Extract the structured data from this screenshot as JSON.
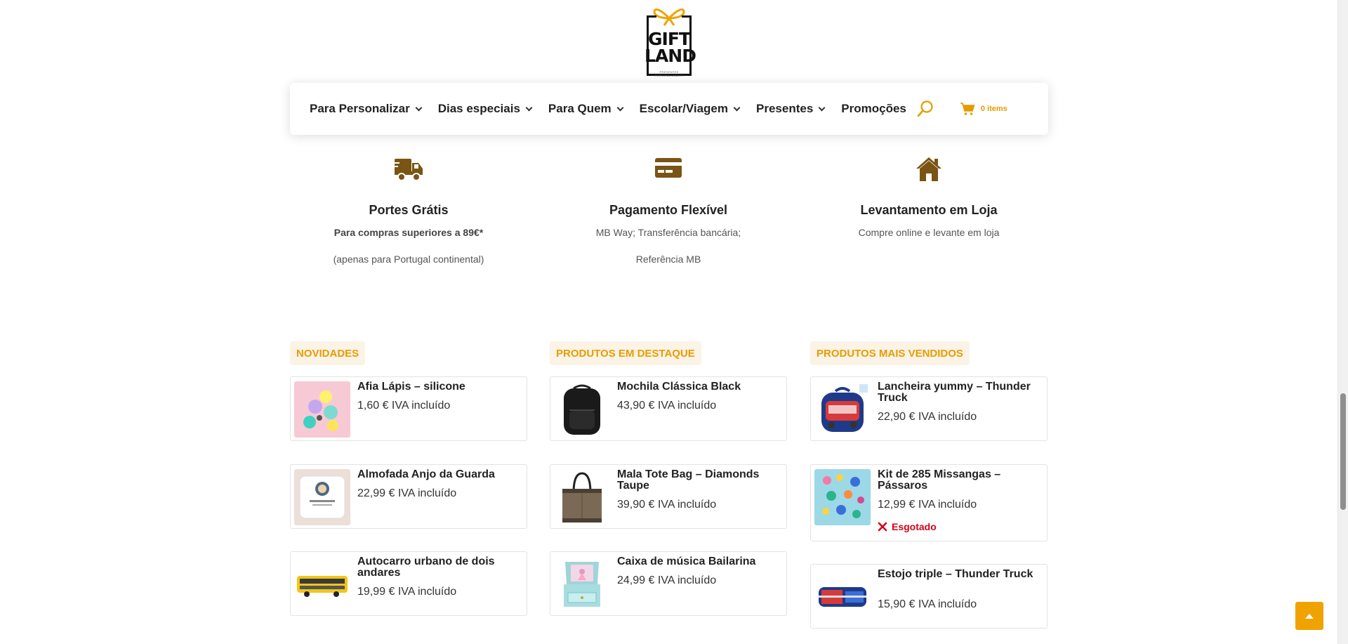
{
  "brand": {
    "logo_top": "GIFT",
    "logo_bottom": "LAND",
    "tagline": "PRESENTES PERSONALIZADOS"
  },
  "nav": {
    "items": [
      {
        "label": "Para Personalizar",
        "dropdown": true
      },
      {
        "label": "Dias especiais",
        "dropdown": true
      },
      {
        "label": "Para Quem",
        "dropdown": true
      },
      {
        "label": "Escolar/Viagem",
        "dropdown": true
      },
      {
        "label": "Presentes",
        "dropdown": true
      },
      {
        "label": "Promoções",
        "dropdown": false
      }
    ],
    "search_icon": "search-icon",
    "cart_icon": "cart-icon",
    "cart_label": "0 items"
  },
  "features": [
    {
      "icon": "truck-icon",
      "title": "Portes Grátis",
      "line1": "Para compras superiores a 89€*",
      "line2": "(apenas para Portugal continental)"
    },
    {
      "icon": "credit-card-icon",
      "title": "Pagamento Flexível",
      "line1": "MB Way;  Transferência bancária;",
      "line2": "Referência MB"
    },
    {
      "icon": "home-icon",
      "title": "Levantamento em Loja",
      "line1": "Compre online e levante em loja",
      "line2": ""
    }
  ],
  "columns": [
    {
      "header": "Novidades",
      "products": [
        {
          "title": "Afia Lápis – silicone",
          "price": "1,60 € IVA incluído"
        },
        {
          "title": "Almofada Anjo da Guarda",
          "price": "22,99 € IVA incluído"
        },
        {
          "title": "Autocarro urbano de dois andares",
          "price": "19,99 € IVA incluído"
        }
      ]
    },
    {
      "header": "Produtos em destaque",
      "products": [
        {
          "title": "Mochila Clássica Black",
          "price": "43,90 € IVA incluído"
        },
        {
          "title": "Mala Tote Bag – Diamonds Taupe",
          "price": "39,90 € IVA incluído"
        },
        {
          "title": "Caixa de música Bailarina",
          "price": "24,99 € IVA incluído"
        }
      ]
    },
    {
      "header": "Produtos mais vendidos",
      "products": [
        {
          "title": "Lancheira yummy – Thunder Truck",
          "price": "22,90 € IVA incluído"
        },
        {
          "title": "Kit de 285 Missangas – Pássaros",
          "price": "12,99 € IVA incluído",
          "stock": "Esgotado"
        },
        {
          "title": "Estojo triple – Thunder Truck",
          "price": "15,90 € IVA incluído"
        }
      ]
    }
  ],
  "colors": {
    "accent": "#E69D00",
    "icon_brown": "#7A5414",
    "out_of_stock": "#D0021B",
    "header_bg": "#FBF3E6"
  },
  "back_to_top_icon": "arrow-up-icon"
}
